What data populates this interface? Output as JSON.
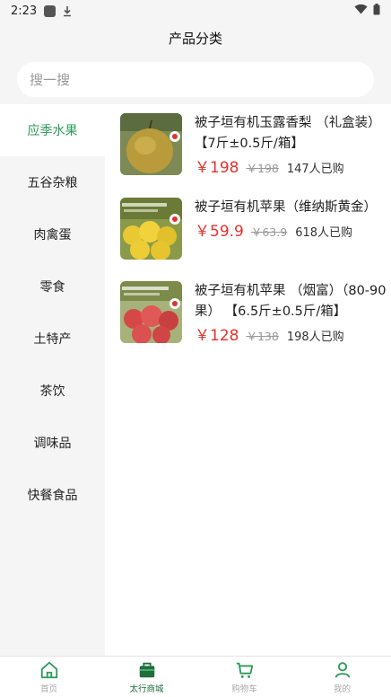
{
  "status": {
    "time": "2:23"
  },
  "header": {
    "title": "产品分类"
  },
  "search": {
    "placeholder": "搜一搜"
  },
  "sidebar": {
    "items": [
      {
        "label": "应季水果",
        "active": true
      },
      {
        "label": "五谷杂粮"
      },
      {
        "label": "肉禽蛋"
      },
      {
        "label": "零食"
      },
      {
        "label": "土特产"
      },
      {
        "label": "茶饮"
      },
      {
        "label": "调味品"
      },
      {
        "label": "快餐食品"
      }
    ]
  },
  "products": [
    {
      "name": "被子垣有机玉露香梨 （礼盒装） 【7斤±0.5斤/箱】",
      "price": "￥198",
      "original_price": "￥198",
      "sold": "147人已购",
      "thumb_icon": "pear-image"
    },
    {
      "name": "被子垣有机苹果（维纳斯黄金）",
      "price": "￥59.9",
      "original_price": "￥63.9",
      "sold": "618人已购",
      "thumb_icon": "yellow-apple-image"
    },
    {
      "name": "被子垣有机苹果 （烟富）（80-90果） 【6.5斤±0.5斤/箱】",
      "price": "￥128",
      "original_price": "￥138",
      "sold": "198人已购",
      "thumb_icon": "red-apple-image"
    }
  ],
  "tabbar": {
    "items": [
      {
        "label": "首页",
        "icon": "home-icon"
      },
      {
        "label": "太行商城",
        "icon": "bag-icon",
        "active": true
      },
      {
        "label": "购物车",
        "icon": "cart-icon"
      },
      {
        "label": "我的",
        "icon": "user-icon"
      }
    ]
  },
  "colors": {
    "accent": "#2e9a5a",
    "price": "#e5322d",
    "tab_active": "#1f6e3b"
  }
}
